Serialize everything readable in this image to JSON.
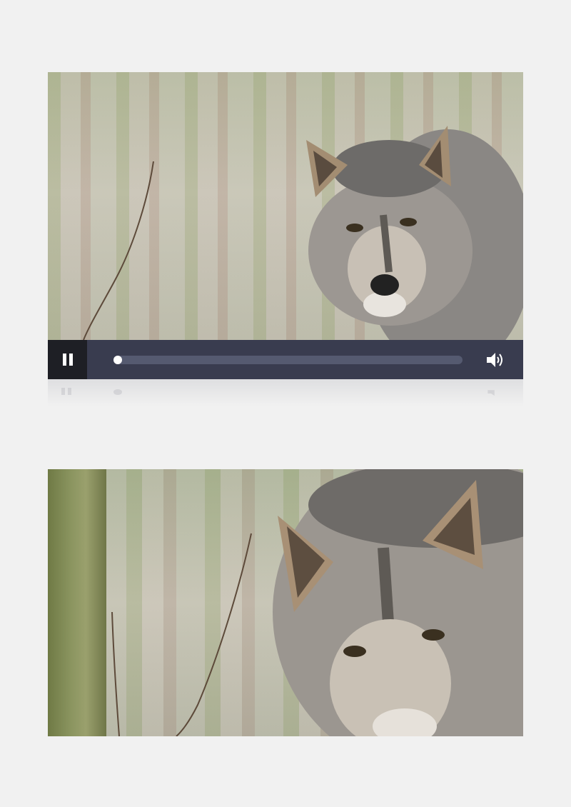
{
  "player": {
    "state": "playing",
    "progress": 0,
    "muted": false,
    "icons": {
      "toggle": "pause-icon",
      "volume": "speaker-volume-icon"
    },
    "colors": {
      "control_bar": "#393c4f",
      "play_button_bg": "#1e1f25",
      "track": "#555a70",
      "knob": "#ffffff",
      "page_background": "#f1f1f1"
    }
  },
  "frames": [
    {
      "scene": "wolf-in-forest"
    },
    {
      "scene": "wolf-close-up"
    }
  ]
}
